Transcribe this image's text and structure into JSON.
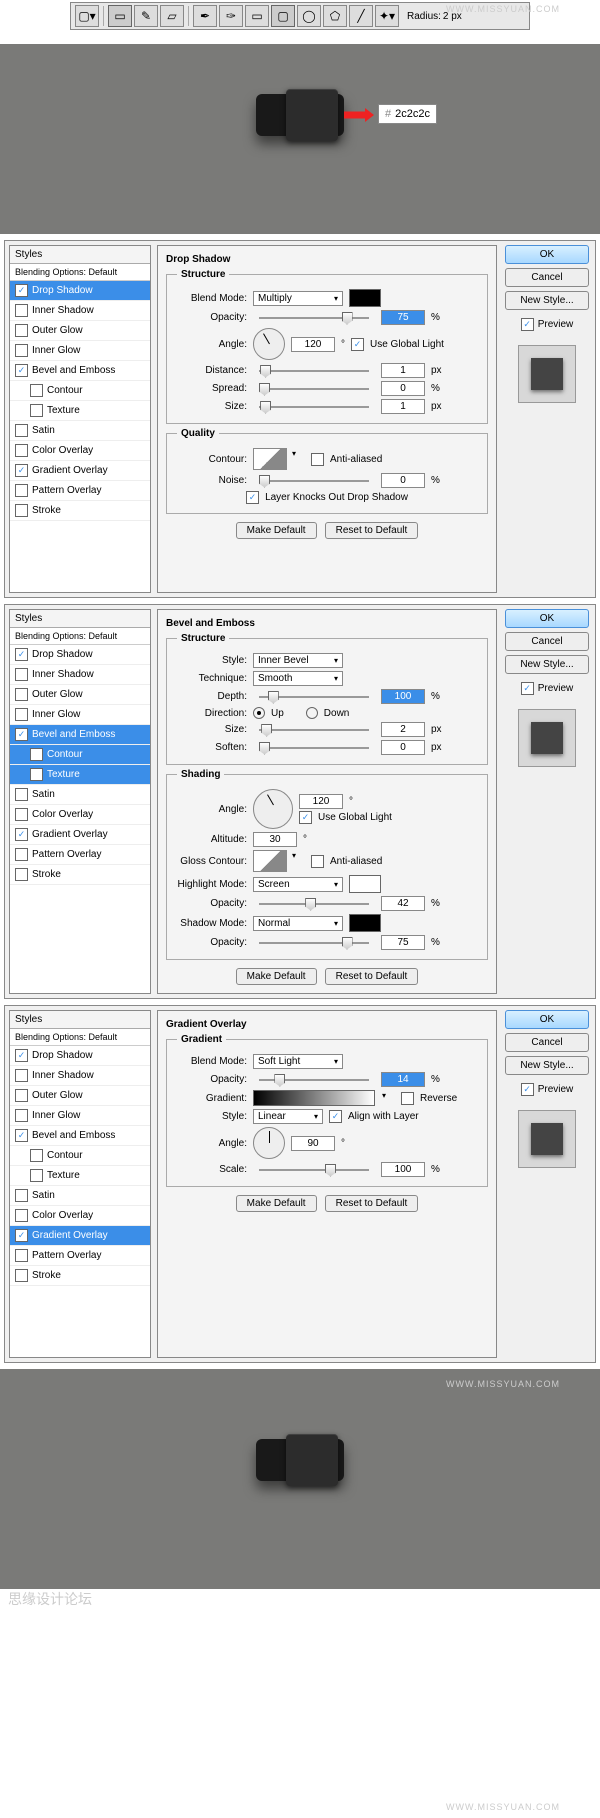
{
  "watermark": "WWW.MISSYUAN.COM",
  "toolbar": {
    "radius_label": "Radius:",
    "radius_value": "2 px"
  },
  "color_callout": {
    "hash": "#",
    "value": "2c2c2c"
  },
  "styles_header": "Styles",
  "blending_default": "Blending Options: Default",
  "style_names": {
    "drop_shadow": "Drop Shadow",
    "inner_shadow": "Inner Shadow",
    "outer_glow": "Outer Glow",
    "inner_glow": "Inner Glow",
    "bevel": "Bevel and Emboss",
    "contour": "Contour",
    "texture": "Texture",
    "satin": "Satin",
    "color_overlay": "Color Overlay",
    "gradient_overlay": "Gradient Overlay",
    "pattern_overlay": "Pattern Overlay",
    "stroke": "Stroke"
  },
  "buttons": {
    "ok": "OK",
    "cancel": "Cancel",
    "new_style": "New Style...",
    "preview": "Preview",
    "make_default": "Make Default",
    "reset": "Reset to Default"
  },
  "ds": {
    "title": "Drop Shadow",
    "structure": "Structure",
    "quality": "Quality",
    "blend_mode_label": "Blend Mode:",
    "blend_mode": "Multiply",
    "opacity_label": "Opacity:",
    "opacity": "75",
    "pct": "%",
    "angle_label": "Angle:",
    "angle": "120",
    "deg": "°",
    "use_global": "Use Global Light",
    "distance_label": "Distance:",
    "distance": "1",
    "px": "px",
    "spread_label": "Spread:",
    "spread": "0",
    "size_label": "Size:",
    "size": "1",
    "contour_label": "Contour:",
    "anti_alias": "Anti-aliased",
    "noise_label": "Noise:",
    "noise": "0",
    "knockout": "Layer Knocks Out Drop Shadow"
  },
  "bv": {
    "title": "Bevel and Emboss",
    "structure": "Structure",
    "shading": "Shading",
    "style_label": "Style:",
    "style": "Inner Bevel",
    "technique_label": "Technique:",
    "technique": "Smooth",
    "depth_label": "Depth:",
    "depth": "100",
    "pct": "%",
    "direction_label": "Direction:",
    "up": "Up",
    "down": "Down",
    "size_label": "Size:",
    "size": "2",
    "px": "px",
    "soften_label": "Soften:",
    "soften": "0",
    "angle_label": "Angle:",
    "angle": "120",
    "deg": "°",
    "use_global": "Use Global Light",
    "altitude_label": "Altitude:",
    "altitude": "30",
    "gloss_label": "Gloss Contour:",
    "anti_alias": "Anti-aliased",
    "highlight_label": "Highlight Mode:",
    "highlight": "Screen",
    "h_opacity_label": "Opacity:",
    "h_opacity": "42",
    "shadow_label": "Shadow Mode:",
    "shadow": "Normal",
    "s_opacity_label": "Opacity:",
    "s_opacity": "75"
  },
  "go": {
    "title": "Gradient Overlay",
    "gradient_group": "Gradient",
    "blend_mode_label": "Blend Mode:",
    "blend_mode": "Soft Light",
    "opacity_label": "Opacity:",
    "opacity": "14",
    "pct": "%",
    "gradient_label": "Gradient:",
    "reverse": "Reverse",
    "style_label": "Style:",
    "style": "Linear",
    "align": "Align with Layer",
    "angle_label": "Angle:",
    "angle": "90",
    "deg": "°",
    "scale_label": "Scale:",
    "scale": "100"
  },
  "footer": "思缘设计论坛"
}
